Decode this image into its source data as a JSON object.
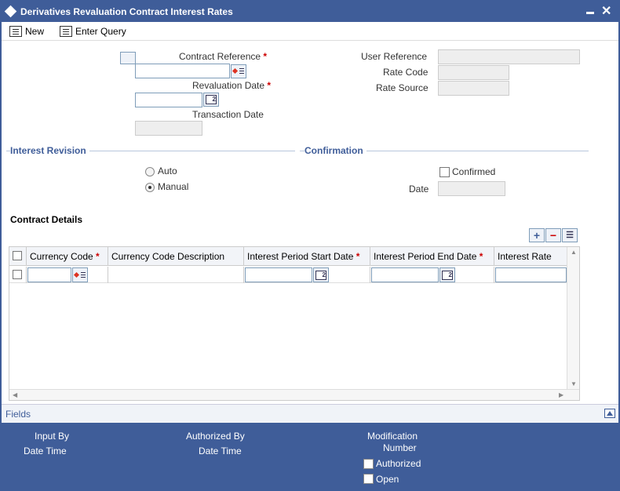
{
  "window": {
    "title": "Derivatives Revaluation Contract Interest Rates"
  },
  "toolbar": {
    "new_label": "New",
    "enter_query_label": "Enter Query"
  },
  "form": {
    "contract_reference_label": "Contract Reference",
    "revaluation_date_label": "Revaluation Date",
    "transaction_date_label": "Transaction Date",
    "user_reference_label": "User Reference",
    "rate_code_label": "Rate Code",
    "rate_source_label": "Rate Source",
    "required_mark": "*"
  },
  "interest_revision": {
    "title": "Interest Revision",
    "auto_label": "Auto",
    "manual_label": "Manual",
    "selected": "Manual"
  },
  "confirmation": {
    "title": "Confirmation",
    "confirmed_label": "Confirmed",
    "date_label": "Date"
  },
  "contract_details": {
    "title": "Contract Details",
    "columns": [
      "Currency Code",
      "Currency Code Description",
      "Interest Period Start Date",
      "Interest Period End Date",
      "Interest Rate"
    ],
    "add_icon": "plus-icon",
    "remove_icon": "minus-icon",
    "view_icon": "list-icon"
  },
  "fields_bar": {
    "label": "Fields"
  },
  "footer": {
    "input_by": "Input By",
    "date_time_1": "Date Time",
    "authorized_by": "Authorized By",
    "date_time_2": "Date Time",
    "modification": "Modification",
    "number": "Number",
    "authorized": "Authorized",
    "open": "Open"
  },
  "colors": {
    "brand": "#3f5d99",
    "required": "#cc0000"
  }
}
